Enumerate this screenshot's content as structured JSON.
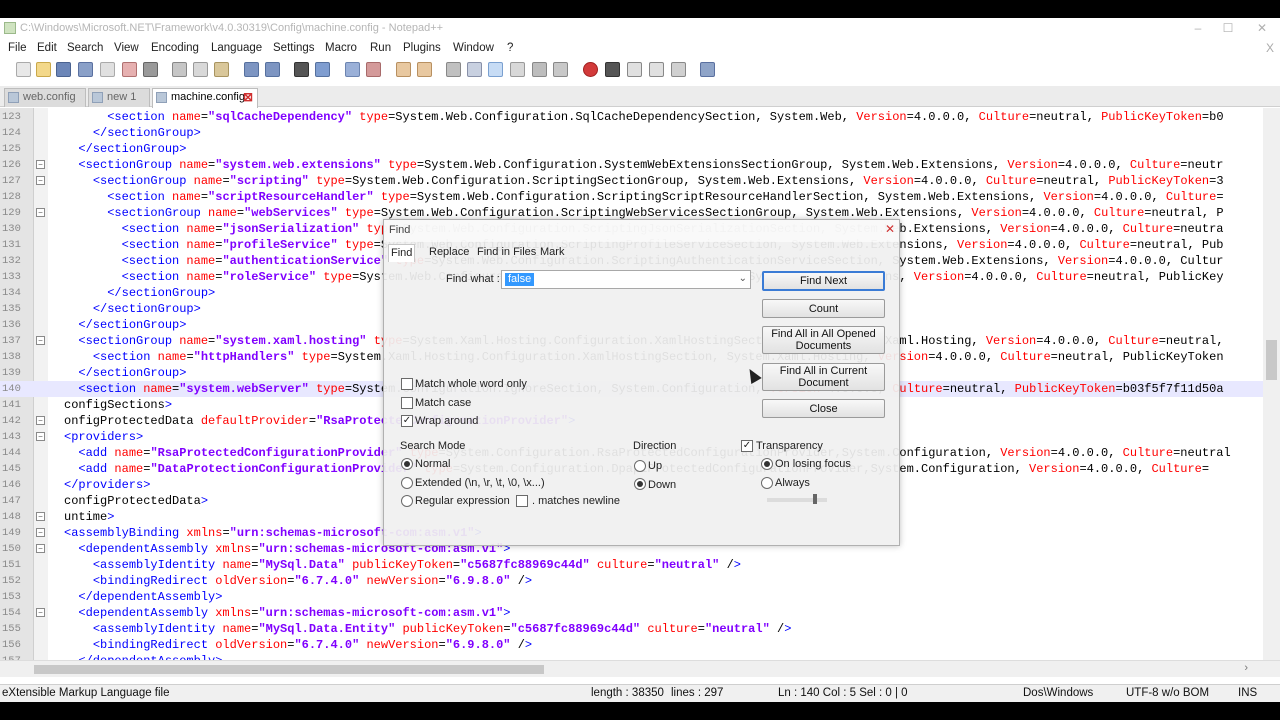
{
  "window": {
    "title": "C:\\Windows\\Microsoft.NET\\Framework\\v4.0.30319\\Config\\machine.config - Notepad++"
  },
  "menu": [
    "File",
    "Edit",
    "Search",
    "View",
    "Encoding",
    "Language",
    "Settings",
    "Macro",
    "Run",
    "Plugins",
    "Window",
    "?"
  ],
  "menu_close": "X",
  "tabs": [
    {
      "label": "web.config",
      "active": false
    },
    {
      "label": "new 1",
      "active": false
    },
    {
      "label": "machine.config",
      "active": true
    }
  ],
  "editor": {
    "lines": [
      {
        "num": "123",
        "html": "      &lt;section name=\"sqlCacheDependency\" type=\"System.Web.Configuration.SqlCacheDependencySection, System.Web, Version=4.0.0.0, Culture=neutral, PublicKeyToken=b0"
      },
      {
        "num": "124",
        "html": "    &lt;/sectionGroup&gt;"
      },
      {
        "num": "125",
        "html": "  &lt;/sectionGroup&gt;"
      },
      {
        "num": "126",
        "html": "  &lt;sectionGroup name=\"system.web.extensions\" type=\"System.Web.Configuration.SystemWebExtensionsSectionGroup, System.Web.Extensions, Version=4.0.0.0, Culture=neutr"
      },
      {
        "num": "127",
        "html": "    &lt;sectionGroup name=\"scripting\" type=\"System.Web.Configuration.ScriptingSectionGroup, System.Web.Extensions, Version=4.0.0.0, Culture=neutral, PublicKeyToken=3"
      },
      {
        "num": "128",
        "html": "      &lt;section name=\"scriptResourceHandler\" type=\"System.Web.Configuration.ScriptingScriptResourceHandlerSection, System.Web.Extensions, Version=4.0.0.0, Culture="
      },
      {
        "num": "129",
        "html": "      &lt;sectionGroup name=\"webServices\" type=\"System.Web.Configuration.ScriptingWebServicesSectionGroup, System.Web.Extensions, Version=4.0.0.0, Culture=neutral, P"
      },
      {
        "num": "130",
        "html": "        &lt;section name=\"jsonSerialization\" type=\"System.Web.Configuration.ScriptingJsonSerializationSection, System.Web.Extensions, Version=4.0.0.0, Culture=neutra"
      },
      {
        "num": "131",
        "html": "        &lt;section name=\"profileService\" type=\"System.Web.Configuration.ScriptingProfileServiceSection, System.Web.Extensions, Version=4.0.0.0, Culture=neutral, Pub"
      },
      {
        "num": "132",
        "html": "        &lt;section name=\"authenticationService\" type=\"System.Web.Configuration.ScriptingAuthenticationServiceSection, System.Web.Extensions, Version=4.0.0.0, Cultur"
      },
      {
        "num": "133",
        "html": "        &lt;section name=\"roleService\" type=\"System.Web.Configuration.ScriptingRoleServiceSection, System.Web.Extensions, Version=4.0.0.0, Culture=neutral, PublicKey"
      },
      {
        "num": "134",
        "html": "      &lt;/sectionGroup&gt;"
      },
      {
        "num": "135",
        "html": "    &lt;/sectionGroup&gt;"
      },
      {
        "num": "136",
        "html": "  &lt;/sectionGroup&gt;"
      },
      {
        "num": "137",
        "html": "  &lt;sectionGroup name=\"system.xaml.hosting\" type=\"System.Xaml.Hosting.Configuration.XamlHostingSectionGroup, System.Xaml.Hosting, Version=4.0.0.0, Culture=neutral,"
      },
      {
        "num": "138",
        "html": "    &lt;section name=\"httpHandlers\" type=\"System.Xaml.Hosting.Configuration.XamlHostingSection, System.Xaml.Hosting, Version=4.0.0.0, Culture=neutral, PublicKeyToken"
      },
      {
        "num": "139",
        "html": "  &lt;/sectionGroup&gt;"
      },
      {
        "num": "140",
        "html": "  &lt;section name=\"system.webServer\" type=\"System.Configuration.IgnoreSection, System.Configuration, Version=4.0.0.0, Culture=neutral, PublicKeyToken=b03f5f7f11d50a"
      },
      {
        "num": "141",
        "html": "configSections&gt;"
      },
      {
        "num": "142",
        "html": "onfigProtectedData defaultProvider=\"RsaProtectedConfigurationProvider\"&gt;"
      },
      {
        "num": "143",
        "html": "&lt;providers&gt;"
      },
      {
        "num": "144",
        "html": "  &lt;add name=\"RsaProtectedConfigurationProvider\" type=\"System.Configuration.RsaProtectedConfigurationProvider,System.Configuration, Version=4.0.0.0, Culture=neutral"
      },
      {
        "num": "145",
        "html": "  &lt;add name=\"DataProtectionConfigurationProvider\" type=\"System.Configuration.DpapiProtectedConfigurationProvider,System.Configuration, Version=4.0.0.0, Culture="
      },
      {
        "num": "146",
        "html": "&lt;/providers&gt;"
      },
      {
        "num": "147",
        "html": "configProtectedData&gt;"
      },
      {
        "num": "148",
        "html": "untime&gt;"
      },
      {
        "num": "149",
        "html": "&lt;assemblyBinding xmlns=\"urn:schemas-microsoft-com:asm.v1\"&gt;"
      },
      {
        "num": "150",
        "html": "  &lt;dependentAssembly xmlns=\"urn:schemas-microsoft-com:asm.v1\"&gt;"
      },
      {
        "num": "151",
        "html": "    &lt;assemblyIdentity name=\"MySql.Data\" publicKeyToken=\"c5687fc88969c44d\" culture=\"neutral\" /&gt;"
      },
      {
        "num": "152",
        "html": "    &lt;bindingRedirect oldVersion=\"6.7.4.0\" newVersion=\"6.9.8.0\" /&gt;"
      },
      {
        "num": "153",
        "html": "  &lt;/dependentAssembly&gt;"
      },
      {
        "num": "154",
        "html": "  &lt;dependentAssembly xmlns=\"urn:schemas-microsoft-com:asm.v1\"&gt;"
      },
      {
        "num": "155",
        "html": "    &lt;assemblyIdentity name=\"MySql.Data.Entity\" publicKeyToken=\"c5687fc88969c44d\" culture=\"neutral\" /&gt;"
      },
      {
        "num": "156",
        "html": "    &lt;bindingRedirect oldVersion=\"6.7.4.0\" newVersion=\"6.9.8.0\" /&gt;"
      },
      {
        "num": "157",
        "html": "  &lt;/dependentAssembly&gt;"
      }
    ],
    "current_line": "140"
  },
  "find_dialog": {
    "title": "Find",
    "tabs": [
      "Find",
      "Replace",
      "Find in Files",
      "Mark"
    ],
    "find_what_label": "Find what :",
    "find_what_value": "false",
    "buttons": {
      "find_next": "Find Next",
      "count": "Count",
      "find_all_opened": "Find All in All Opened Documents",
      "find_all_current": "Find All in Current Document",
      "close": "Close"
    },
    "options": {
      "whole_word": "Match whole word only",
      "match_case": "Match case",
      "wrap_around": "Wrap around"
    },
    "search_mode": {
      "label": "Search Mode",
      "normal": "Normal",
      "extended": "Extended (\\n, \\r, \\t, \\0, \\x...)",
      "regex": "Regular expression",
      "matches_newline": ". matches newline"
    },
    "direction": {
      "label": "Direction",
      "up": "Up",
      "down": "Down"
    },
    "transparency": {
      "label": "Transparency",
      "on_losing_focus": "On losing focus",
      "always": "Always"
    }
  },
  "status": {
    "file_type": "eXtensible Markup Language file",
    "length": "length : 38350",
    "lines": "lines : 297",
    "position": "Ln : 140   Col : 5   Sel : 0 | 0",
    "eol": "Dos\\Windows",
    "encoding": "UTF-8 w/o BOM",
    "mode": "INS"
  },
  "colors": {
    "tag": "#0000ff",
    "attr": "#ff0000",
    "value": "#8000ff",
    "highlight": "#e8e8ff",
    "default_button": "#3a7bd5"
  }
}
